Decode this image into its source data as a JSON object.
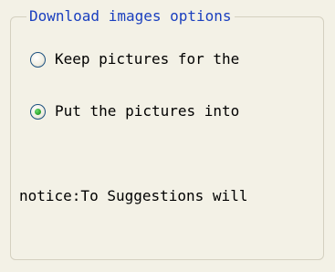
{
  "groupbox": {
    "title": "Download images options"
  },
  "options": [
    {
      "label": "Keep pictures for the",
      "selected": false
    },
    {
      "label": "Put the pictures into",
      "selected": true
    }
  ],
  "notice": "notice:To Suggestions will",
  "colors": {
    "background": "#f3f1e6",
    "legend_text": "#1a3fbf",
    "group_border": "#d4d0c0",
    "radio_border": "#1c5180",
    "radio_dot": "#2fa72f"
  }
}
